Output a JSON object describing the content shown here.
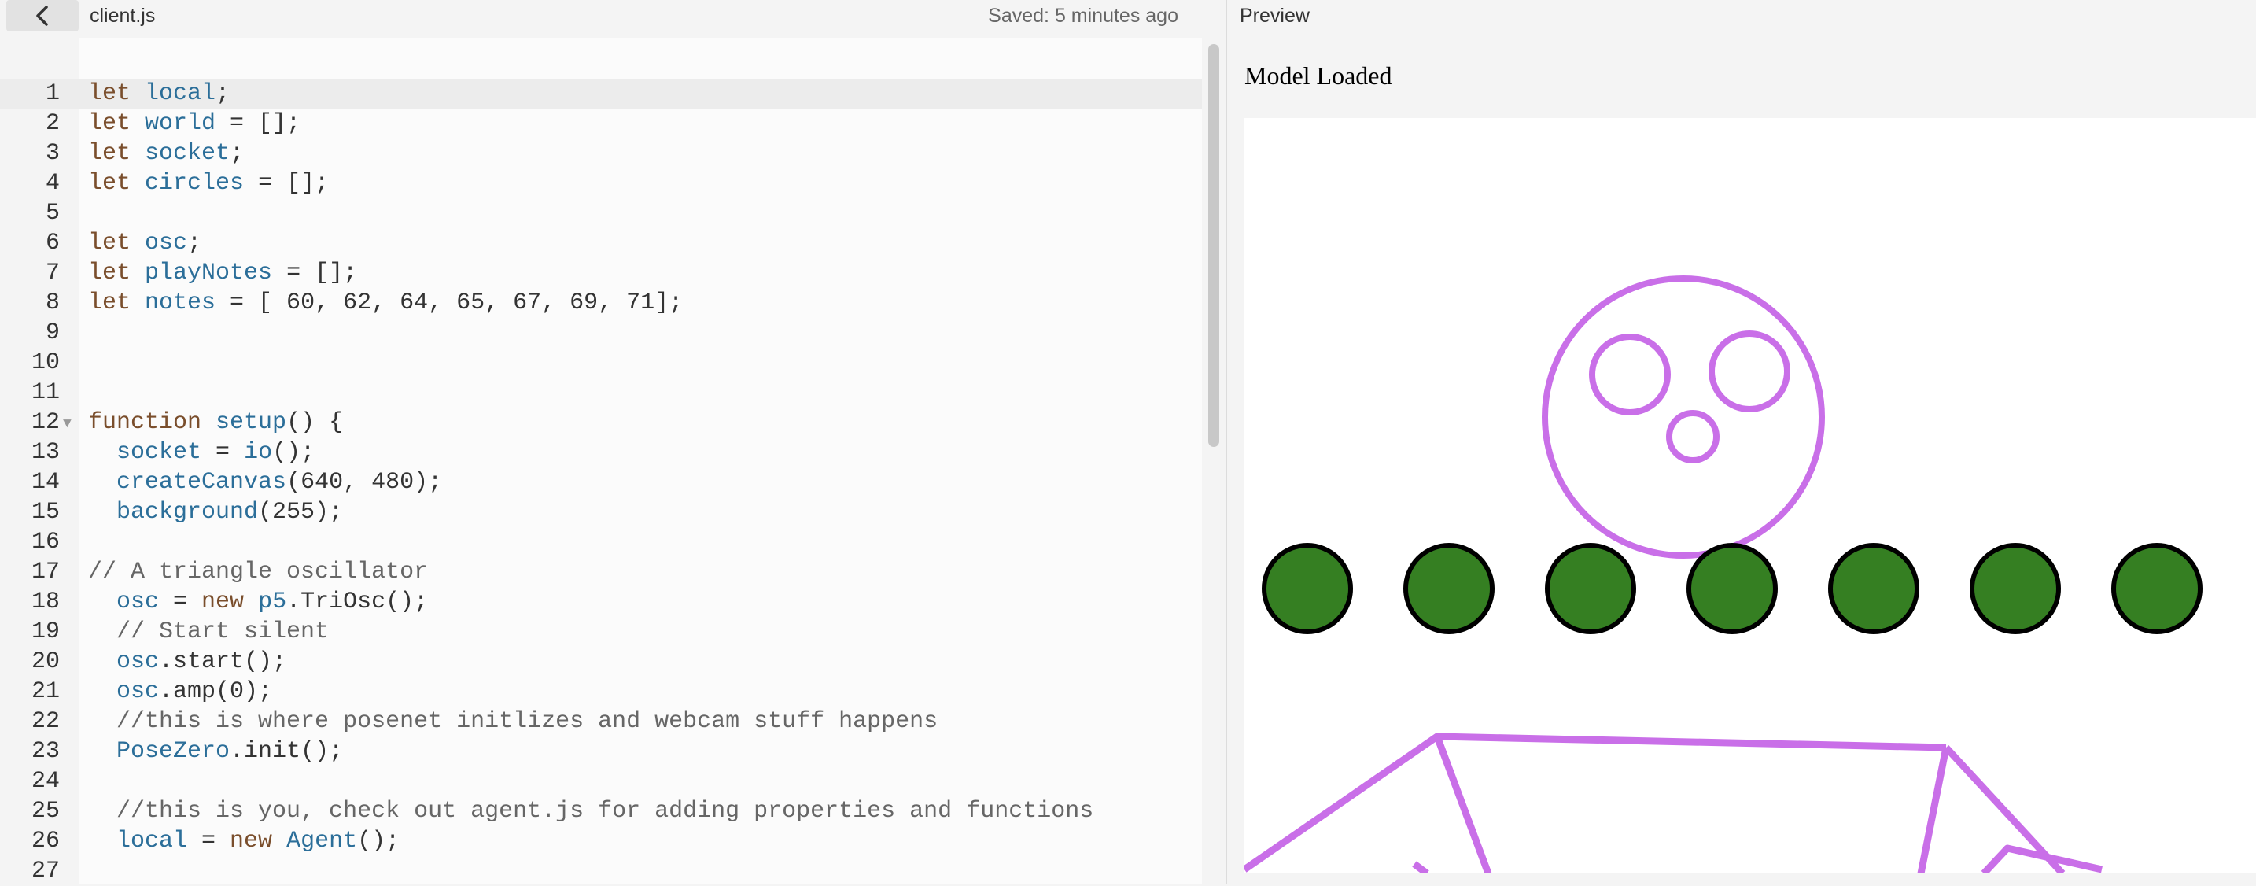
{
  "header": {
    "filename": "client.js",
    "saved_status": "Saved: 5 minutes ago",
    "preview_label": "Preview"
  },
  "editor": {
    "lines": [
      {
        "n": "1",
        "code": "let local;"
      },
      {
        "n": "2",
        "code": "let world = [];"
      },
      {
        "n": "3",
        "code": "let socket;"
      },
      {
        "n": "4",
        "code": "let circles = [];"
      },
      {
        "n": "5",
        "code": ""
      },
      {
        "n": "6",
        "code": "let osc;"
      },
      {
        "n": "7",
        "code": "let playNotes = [];"
      },
      {
        "n": "8",
        "code": "let notes = [ 60, 62, 64, 65, 67, 69, 71];"
      },
      {
        "n": "9",
        "code": ""
      },
      {
        "n": "10",
        "code": ""
      },
      {
        "n": "11",
        "code": ""
      },
      {
        "n": "12",
        "code": "function setup() {"
      },
      {
        "n": "13",
        "code": "  socket = io();"
      },
      {
        "n": "14",
        "code": "  createCanvas(640, 480);"
      },
      {
        "n": "15",
        "code": "  background(255);"
      },
      {
        "n": "16",
        "code": ""
      },
      {
        "n": "17",
        "code": "// A triangle oscillator"
      },
      {
        "n": "18",
        "code": "  osc = new p5.TriOsc();"
      },
      {
        "n": "19",
        "code": "  // Start silent"
      },
      {
        "n": "20",
        "code": "  osc.start();"
      },
      {
        "n": "21",
        "code": "  osc.amp(0);"
      },
      {
        "n": "22",
        "code": "  //this is where posenet initlizes and webcam stuff happens"
      },
      {
        "n": "23",
        "code": "  PoseZero.init();"
      },
      {
        "n": "24",
        "code": ""
      },
      {
        "n": "25",
        "code": "  //this is you, check out agent.js for adding properties and functions"
      },
      {
        "n": "26",
        "code": "  local = new Agent();"
      },
      {
        "n": "27",
        "code": ""
      }
    ]
  },
  "preview": {
    "status_text": "Model Loaded",
    "colors": {
      "face": "#c96fe8",
      "circle_fill": "#357f22",
      "circle_stroke": "#000000"
    }
  }
}
